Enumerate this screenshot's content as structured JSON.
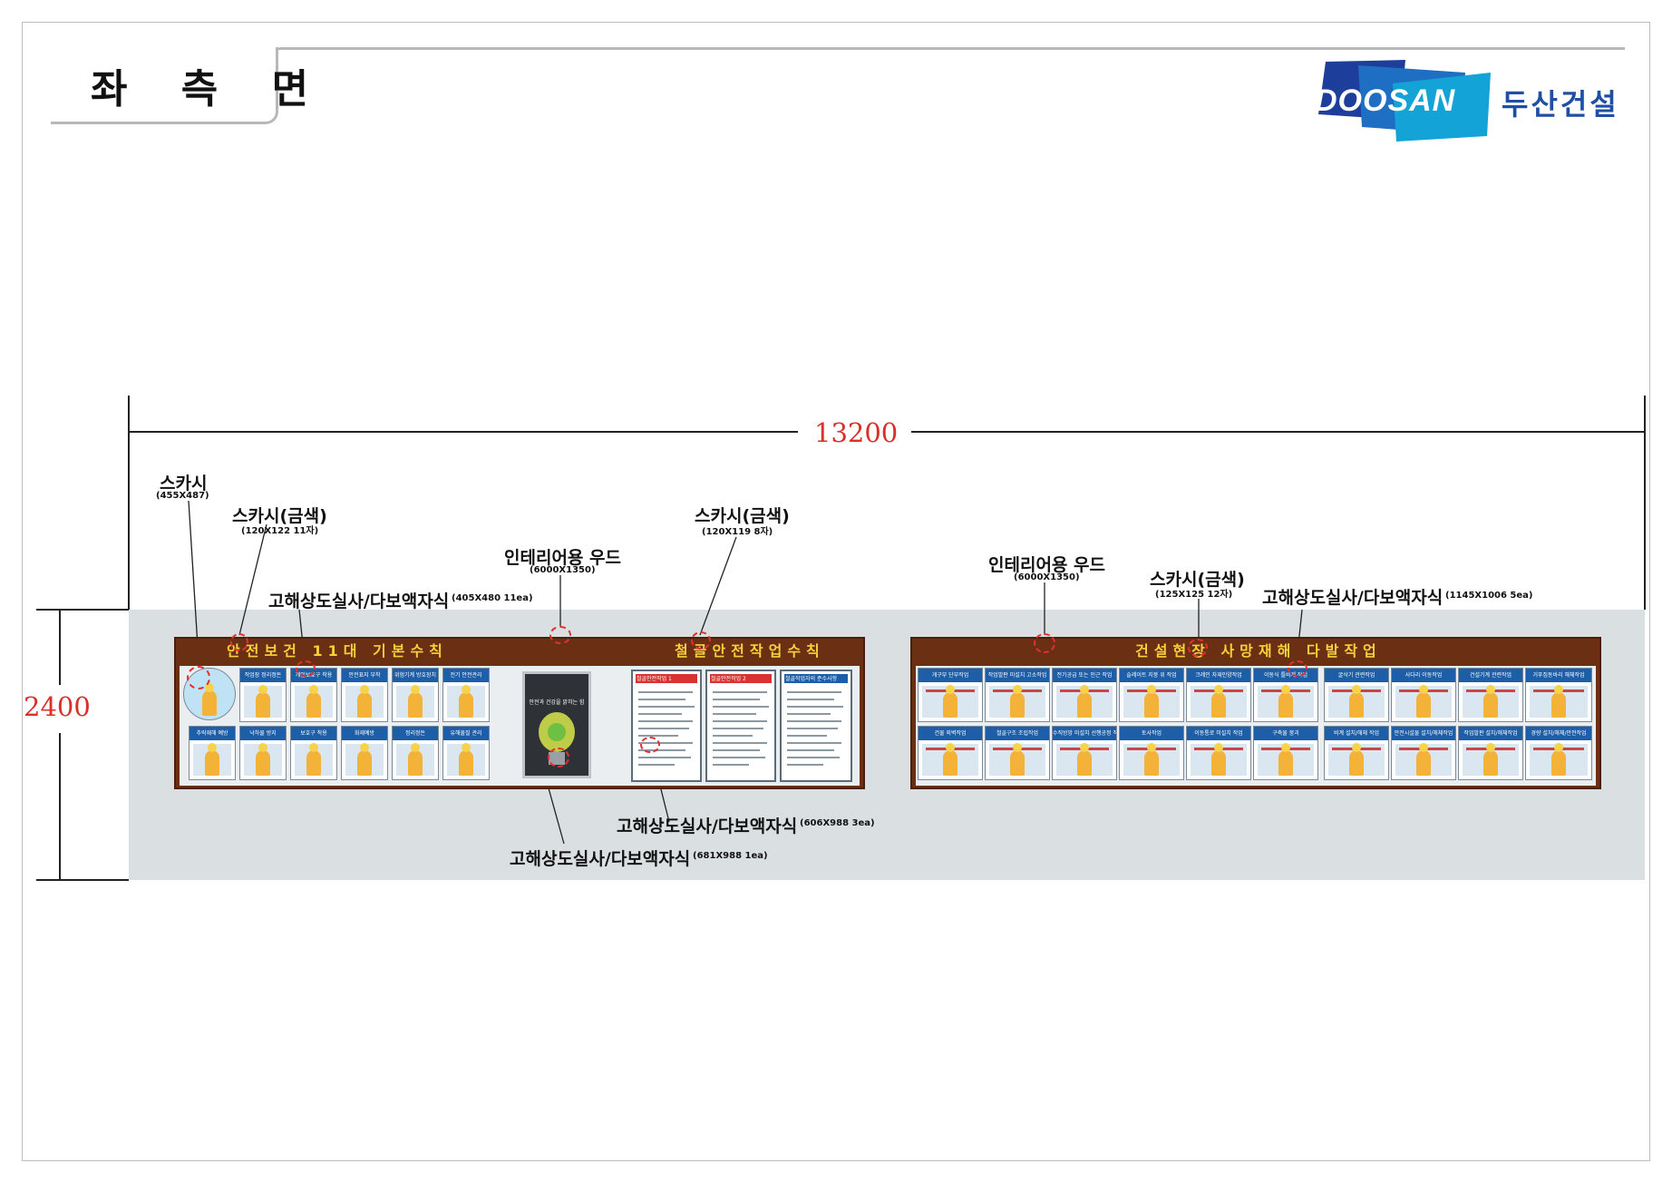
{
  "header": {
    "title": "좌 측 면",
    "brand_logo": "DOOSAN",
    "brand_name": "두산건설"
  },
  "dimensions": {
    "width": "13200",
    "height": "2400"
  },
  "boards": {
    "left_title_a": "안전보건 11대 기본수칙",
    "left_title_b": "철골안전작업수칙",
    "right_title": "건설현장 사망재해 다발작업"
  },
  "labels": {
    "scaffold_sign": {
      "name": "스카시",
      "spec": "(455X487)"
    },
    "gold_letters_left": {
      "name": "스카시(금색)",
      "spec": "(120X122 11자)"
    },
    "wood_left": {
      "name": "인테리어용 우드",
      "spec": "(6000X1350)"
    },
    "gold_letters_mid": {
      "name": "스카시(금색)",
      "spec": "(120X119 8자)"
    },
    "print_posters_left": {
      "name": "고해상도실사/다보액자식",
      "spec": "(405X480 11ea)"
    },
    "wood_right": {
      "name": "인테리어용 우드",
      "spec": "(6000X1350)"
    },
    "gold_letters_right": {
      "name": "스카시(금색)",
      "spec": "(125X125 12자)"
    },
    "print_posters_right": {
      "name": "고해상도실사/다보액자식",
      "spec": "(1145X1006 5ea)"
    },
    "print_docs": {
      "name": "고해상도실사/다보액자식",
      "spec": "(606X988 3ea)"
    },
    "print_bulb": {
      "name": "고해상도실사/다보액자식",
      "spec": "(681X988 1ea)"
    }
  },
  "left_posters_top": [
    "작업장 정리정돈",
    "개인보호구 착용",
    "안전표지 부착",
    "위험기계 방호장치",
    "전기 안전관리",
    "유해물질 관리"
  ],
  "left_posters_bottom": [
    "추락재해 예방",
    "낙하물 방지",
    "보호구 착용",
    "화재예방",
    "정리정돈"
  ],
  "right_posters_top": [
    "개구부 단부작업",
    "작업발판 미설치 고소작업",
    "전기공급 또는 인근 작업",
    "슬레이트 지붕 위 작업",
    "크레인 자재인양작업",
    "이동식 틀비계 작업",
    "굴삭기 관련작업",
    "사다리 이동작업",
    "건설기계 관련작업",
    "거푸집동바리 해체작업"
  ],
  "right_posters_bottom": [
    "건물 외벽작업",
    "철골구조 조립작업",
    "수직방망 미설치 선행공정 작업",
    "토사작업",
    "이동통로 미설치 작업",
    "구축물 붕괴",
    "비계 설치/해체 작업",
    "안전시설물 설치/해체작업",
    "작업발판 설치/해체작업",
    "경량 설치/해체/안전작업"
  ],
  "bulb_poster_caption": "안전과 건강을 밝히는 힘",
  "doc_posters": [
    "철골안전작업 1",
    "철골안전작업 2",
    "철골작업자의 준수사항"
  ],
  "colors": {
    "dimension": "#d9302a",
    "board_frame": "#6b2f14",
    "gold_letters": "#f5d23a",
    "wall": "#dadfe2",
    "marker": "#e23030"
  }
}
